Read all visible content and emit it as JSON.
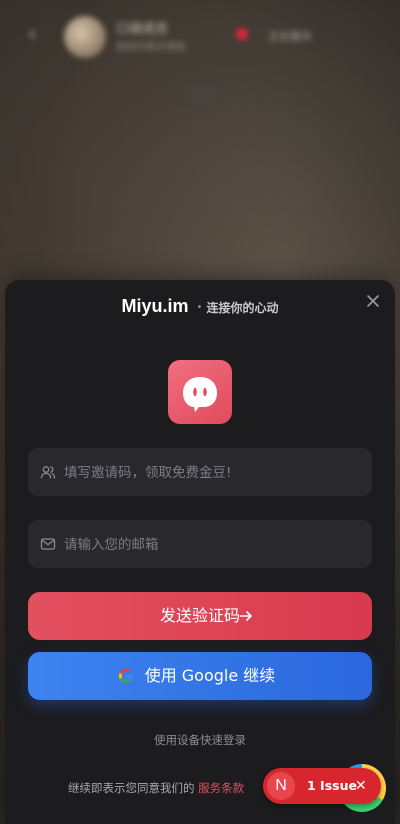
{
  "background": {
    "contact_name": "口袋成员",
    "contact_sub": "她很好聊天噢她",
    "right_status": "正在聊天"
  },
  "modal": {
    "brand": "Miyu.im",
    "separator": "•",
    "tagline": "连接你的心动",
    "invite": {
      "placeholder": "填写邀请码，领取免费金豆!"
    },
    "email": {
      "placeholder": "请输入您的邮箱"
    },
    "send_code_label": "发送验证码",
    "google_label": "使用 Google 继续",
    "device_login_label": "使用设备快速登录",
    "terms_prefix": "继续即表示您同意我们的",
    "terms_link": "服务条款"
  },
  "issue_badge": {
    "icon_letter": "N",
    "label": "1 Issue"
  },
  "colors": {
    "accent": "#e3505f",
    "google_blue": "#3d84f0",
    "modal_bg": "#1c1c1f",
    "field_bg": "#29292d"
  }
}
